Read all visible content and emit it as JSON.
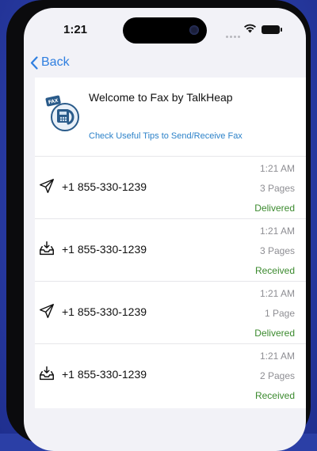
{
  "statusbar": {
    "time": "1:21"
  },
  "nav": {
    "back_label": "Back"
  },
  "welcome": {
    "title": "Welcome to Fax by TalkHeap",
    "tips_link": "Check Useful Tips to Send/Receive Fax",
    "logo_text": "FAX"
  },
  "faxes": [
    {
      "direction": "sent",
      "icon": "send-icon",
      "number": "+1 855-330-1239",
      "time": "1:21 AM",
      "pages": "3 Pages",
      "status": "Delivered"
    },
    {
      "direction": "received",
      "icon": "inbox-icon",
      "number": "+1 855-330-1239",
      "time": "1:21 AM",
      "pages": "3 Pages",
      "status": "Received"
    },
    {
      "direction": "sent",
      "icon": "send-icon",
      "number": "+1 855-330-1239",
      "time": "1:21 AM",
      "pages": "1 Page",
      "status": "Delivered"
    },
    {
      "direction": "received",
      "icon": "inbox-icon",
      "number": "+1 855-330-1239",
      "time": "1:21 AM",
      "pages": "2 Pages",
      "status": "Received"
    }
  ],
  "colors": {
    "accent": "#2f7fe0",
    "link": "#2c82c9",
    "status_green": "#3b8a2e",
    "background": "#2b3fa6"
  }
}
